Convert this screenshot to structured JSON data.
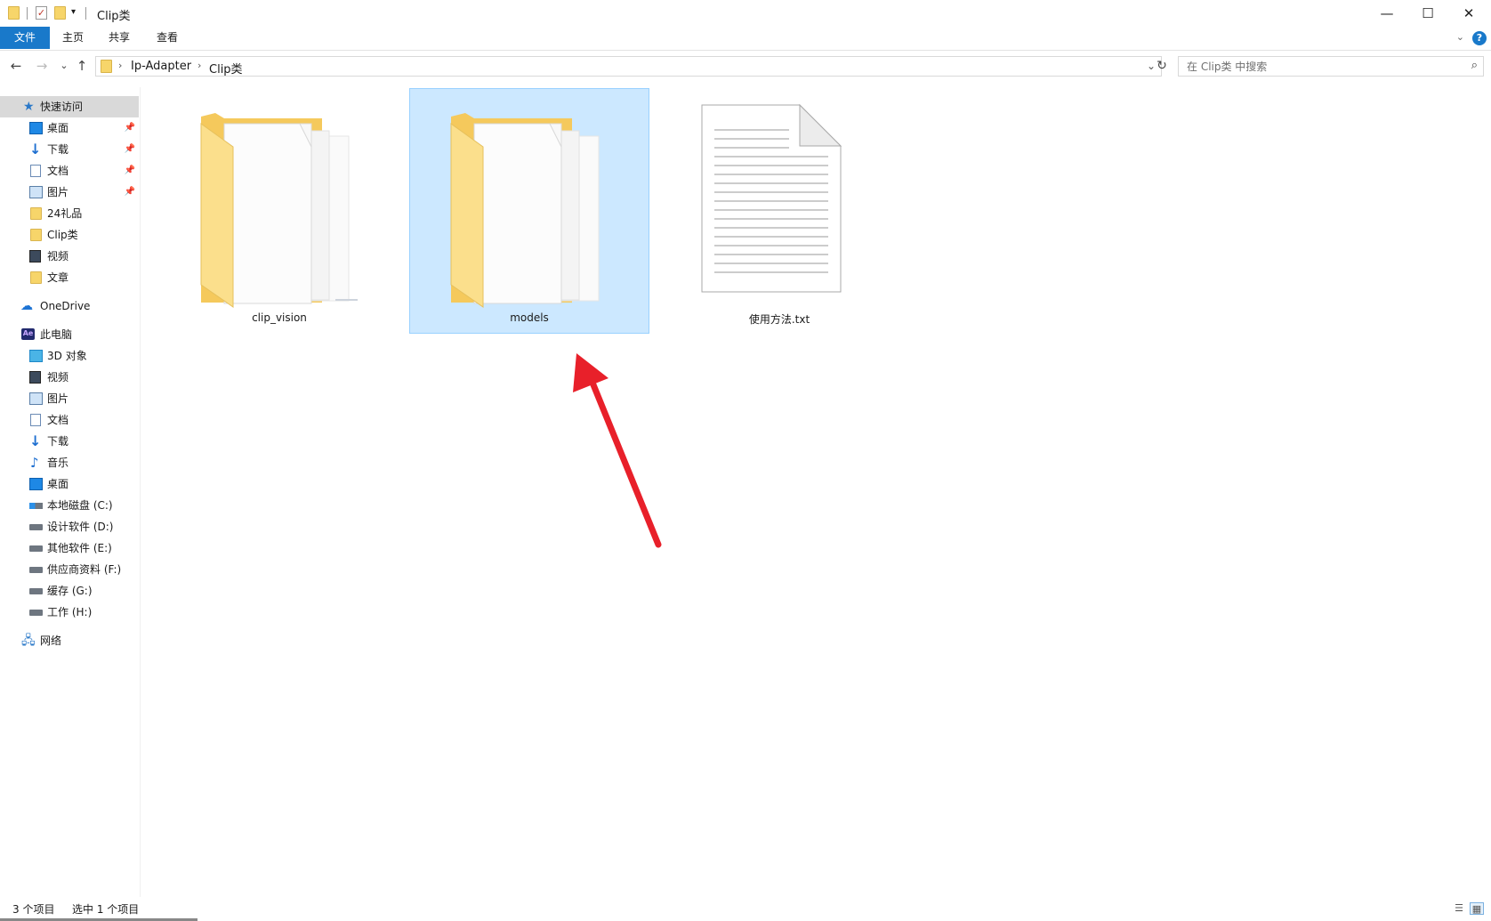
{
  "window": {
    "title": "Clip类",
    "quick_access_dropdown": "▾",
    "controls": {
      "minimize": "—",
      "maximize": "☐",
      "close": "✕"
    }
  },
  "ribbon": {
    "tabs": [
      {
        "label": "文件",
        "active": true
      },
      {
        "label": "主页",
        "active": false
      },
      {
        "label": "共享",
        "active": false
      },
      {
        "label": "查看",
        "active": false
      }
    ],
    "help": "?"
  },
  "nav": {
    "back": "←",
    "forward": "→",
    "recent": "⌄",
    "up": "↑",
    "breadcrumb": [
      "Ip-Adapter",
      "Clip类"
    ],
    "refresh": "↻"
  },
  "search": {
    "placeholder": "在 Clip类 中搜索"
  },
  "sidebar": {
    "quick_access": {
      "label": "快速访问",
      "icon": "star-icon"
    },
    "quick_items": [
      {
        "label": "桌面",
        "icon": "desktop-icon",
        "pinned": true
      },
      {
        "label": "下载",
        "icon": "download-icon",
        "pinned": true
      },
      {
        "label": "文档",
        "icon": "document-icon",
        "pinned": true
      },
      {
        "label": "图片",
        "icon": "pictures-icon",
        "pinned": true
      },
      {
        "label": "24礼品",
        "icon": "folder-icon",
        "pinned": false
      },
      {
        "label": "Clip类",
        "icon": "folder-icon",
        "pinned": false
      },
      {
        "label": "视频",
        "icon": "video-icon",
        "pinned": false
      },
      {
        "label": "文章",
        "icon": "folder-icon",
        "pinned": false
      }
    ],
    "onedrive": {
      "label": "OneDrive",
      "icon": "cloud-icon"
    },
    "this_pc": {
      "label": "此电脑",
      "icon": "pc-icon",
      "icon_text": "Ae"
    },
    "pc_items": [
      {
        "label": "3D 对象",
        "icon": "3d-objects-icon"
      },
      {
        "label": "视频",
        "icon": "video-icon"
      },
      {
        "label": "图片",
        "icon": "pictures-icon"
      },
      {
        "label": "文档",
        "icon": "document-icon"
      },
      {
        "label": "下载",
        "icon": "download-icon"
      },
      {
        "label": "音乐",
        "icon": "music-icon"
      },
      {
        "label": "桌面",
        "icon": "desktop-icon"
      },
      {
        "label": "本地磁盘 (C:)",
        "icon": "system-drive-icon"
      },
      {
        "label": "设计软件 (D:)",
        "icon": "drive-icon"
      },
      {
        "label": "其他软件 (E:)",
        "icon": "drive-icon"
      },
      {
        "label": "供应商资料 (F:)",
        "icon": "drive-icon"
      },
      {
        "label": "缓存 (G:)",
        "icon": "drive-icon"
      },
      {
        "label": "工作 (H:)",
        "icon": "drive-icon"
      }
    ],
    "network": {
      "label": "网络",
      "icon": "network-icon"
    }
  },
  "files": [
    {
      "name": "clip_vision",
      "type": "folder",
      "selected": false
    },
    {
      "name": "models",
      "type": "folder",
      "selected": true
    },
    {
      "name": "使用方法.txt",
      "type": "text-file",
      "selected": false
    }
  ],
  "status": {
    "item_count": "3 个项目",
    "selection": "选中 1 个项目"
  },
  "annotation": {
    "arrow_color": "#e8202a"
  },
  "colors": {
    "accent": "#1979ca",
    "selection_bg": "#cce8ff",
    "selection_border": "#99d1ff",
    "folder": "#f7d56a"
  }
}
